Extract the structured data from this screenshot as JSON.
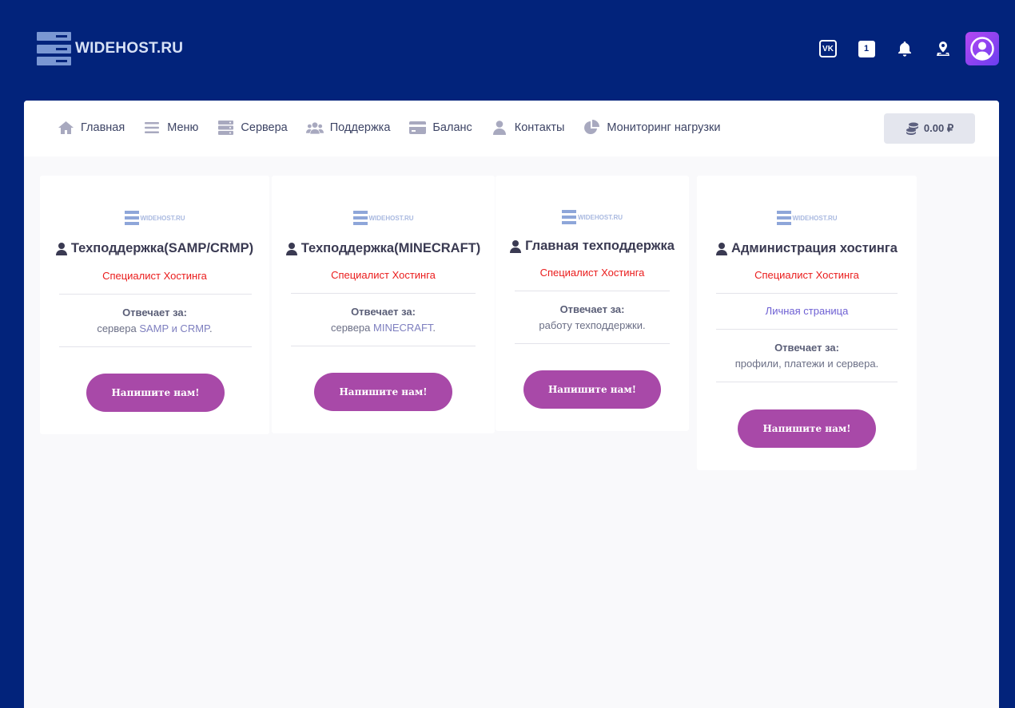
{
  "header": {
    "logo_text": "WIDEHOST.RU",
    "icons": [
      {
        "name": "vk-icon",
        "label": "VK"
      },
      {
        "name": "notification-count-badge",
        "label": "1"
      },
      {
        "name": "bell-icon"
      },
      {
        "name": "map-pin-icon"
      },
      {
        "name": "user-avatar-icon"
      }
    ]
  },
  "nav": {
    "items": [
      {
        "label": "Главная",
        "icon": "home-icon"
      },
      {
        "label": "Меню",
        "icon": "menu-icon"
      },
      {
        "label": "Сервера",
        "icon": "server-icon"
      },
      {
        "label": "Поддержка",
        "icon": "users-icon"
      },
      {
        "label": "Баланс",
        "icon": "credit-card-icon"
      },
      {
        "label": "Контакты",
        "icon": "user-icon"
      },
      {
        "label": "Мониторинг нагрузки",
        "icon": "pie-chart-icon"
      }
    ],
    "balance": "0.00 ₽"
  },
  "cards": [
    {
      "logo_text": "WIDEHOST.RU",
      "title": "Техподдержка(SAMP/CRMP)",
      "role": "Специалист Хостинга",
      "resp_label": "Отвечает за:",
      "resp_prefix": "сервера ",
      "resp_accent": "SAMP и CRMP",
      "resp_suffix": ".",
      "button": "Напишите нам!"
    },
    {
      "logo_text": "WIDEHOST.RU",
      "title": "Техподдержка(MINECRAFT)",
      "role": "Специалист Хостинга",
      "resp_label": "Отвечает за:",
      "resp_prefix": "сервера ",
      "resp_accent": "MINECRAFT",
      "resp_suffix": ".",
      "button": "Напишите нам!"
    },
    {
      "logo_text": "WIDEHOST.RU",
      "title": "Главная техподдержка",
      "role": "Специалист Хостинга",
      "resp_label": "Отвечает за:",
      "resp_text": "работу техподдержки.",
      "button": "Напишите нам!"
    },
    {
      "logo_text": "WIDEHOST.RU",
      "title": "Администрация хостинга",
      "role": "Специалист Хостинга",
      "link": "Личная страница",
      "resp_label": "Отвечает за:",
      "resp_text": "профили, платежи и сервера.",
      "button": "Напишите нам!"
    }
  ],
  "colors": {
    "background": "#02237b",
    "accent_button": "#a849a8",
    "role_text": "#ea1c1c",
    "link": "#6d5fd3"
  }
}
